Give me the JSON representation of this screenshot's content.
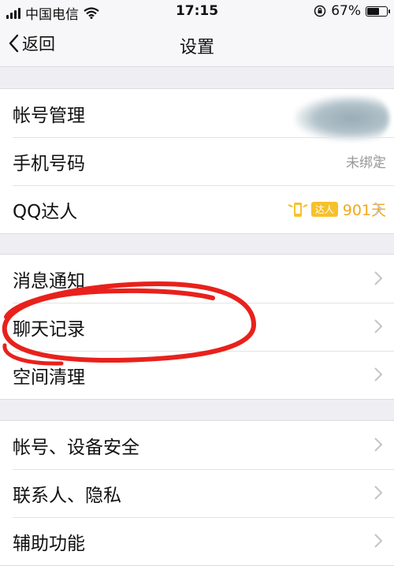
{
  "status_bar": {
    "carrier": "中国电信",
    "time": "17:15",
    "battery": "67%",
    "battery_level": 0.67
  },
  "nav": {
    "back_label": "返回",
    "title": "设置"
  },
  "group1": [
    {
      "label": "帐号管理"
    },
    {
      "label": "手机号码",
      "value": "未绑定"
    },
    {
      "label": "QQ达人",
      "badge": "达人",
      "days": "901天"
    }
  ],
  "group2": [
    {
      "label": "消息通知"
    },
    {
      "label": "聊天记录"
    },
    {
      "label": "空间清理"
    }
  ],
  "group3": [
    {
      "label": "帐号、设备安全"
    },
    {
      "label": "联系人、隐私"
    },
    {
      "label": "辅助功能"
    }
  ],
  "colors": {
    "accent_annotation": "#e8211c",
    "badge": "#f6c12c",
    "days": "#f1a81a"
  }
}
